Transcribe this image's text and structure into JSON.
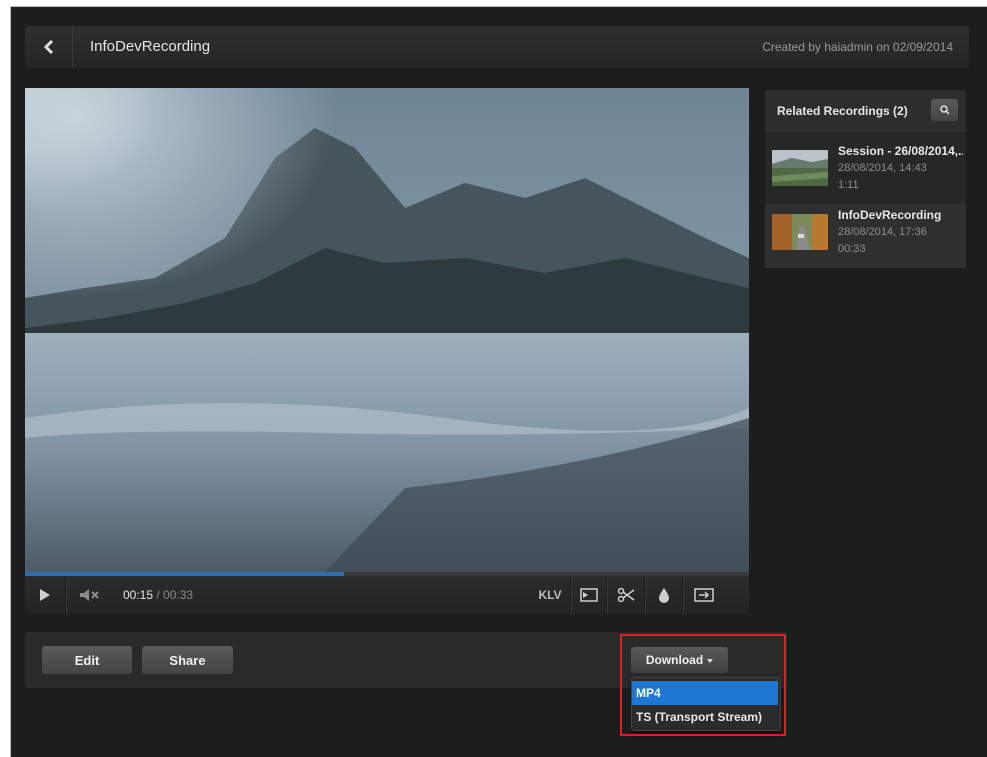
{
  "header": {
    "title": "InfoDevRecording",
    "created": "Created by haiadmin on 02/09/2014"
  },
  "player": {
    "current_time": "00:15",
    "separator": " / ",
    "duration": "00:33",
    "progress": 0.44,
    "klv_label": "KLV"
  },
  "actions": {
    "edit_label": "Edit",
    "share_label": "Share",
    "download_label": "Download",
    "download_options": [
      "MP4",
      "TS (Transport Stream)"
    ],
    "selected_option": "MP4"
  },
  "related": {
    "title": "Related Recordings (2)",
    "items": [
      {
        "title": "Session - 26/08/2014,...",
        "date": "28/08/2014, 14:43",
        "duration": "1:11"
      },
      {
        "title": "InfoDevRecording",
        "date": "28/08/2014, 17:36",
        "duration": "00:33"
      }
    ]
  },
  "colors": {
    "accent": "#1e78d2",
    "progress": "#2f6fb0",
    "highlight": "#e31b23",
    "background": "#1d1d1d"
  },
  "icons": [
    "chevron-left-icon",
    "play-icon",
    "mute-icon",
    "snapshot-icon",
    "scissors-icon",
    "drop-icon",
    "exit-icon",
    "search-icon"
  ]
}
